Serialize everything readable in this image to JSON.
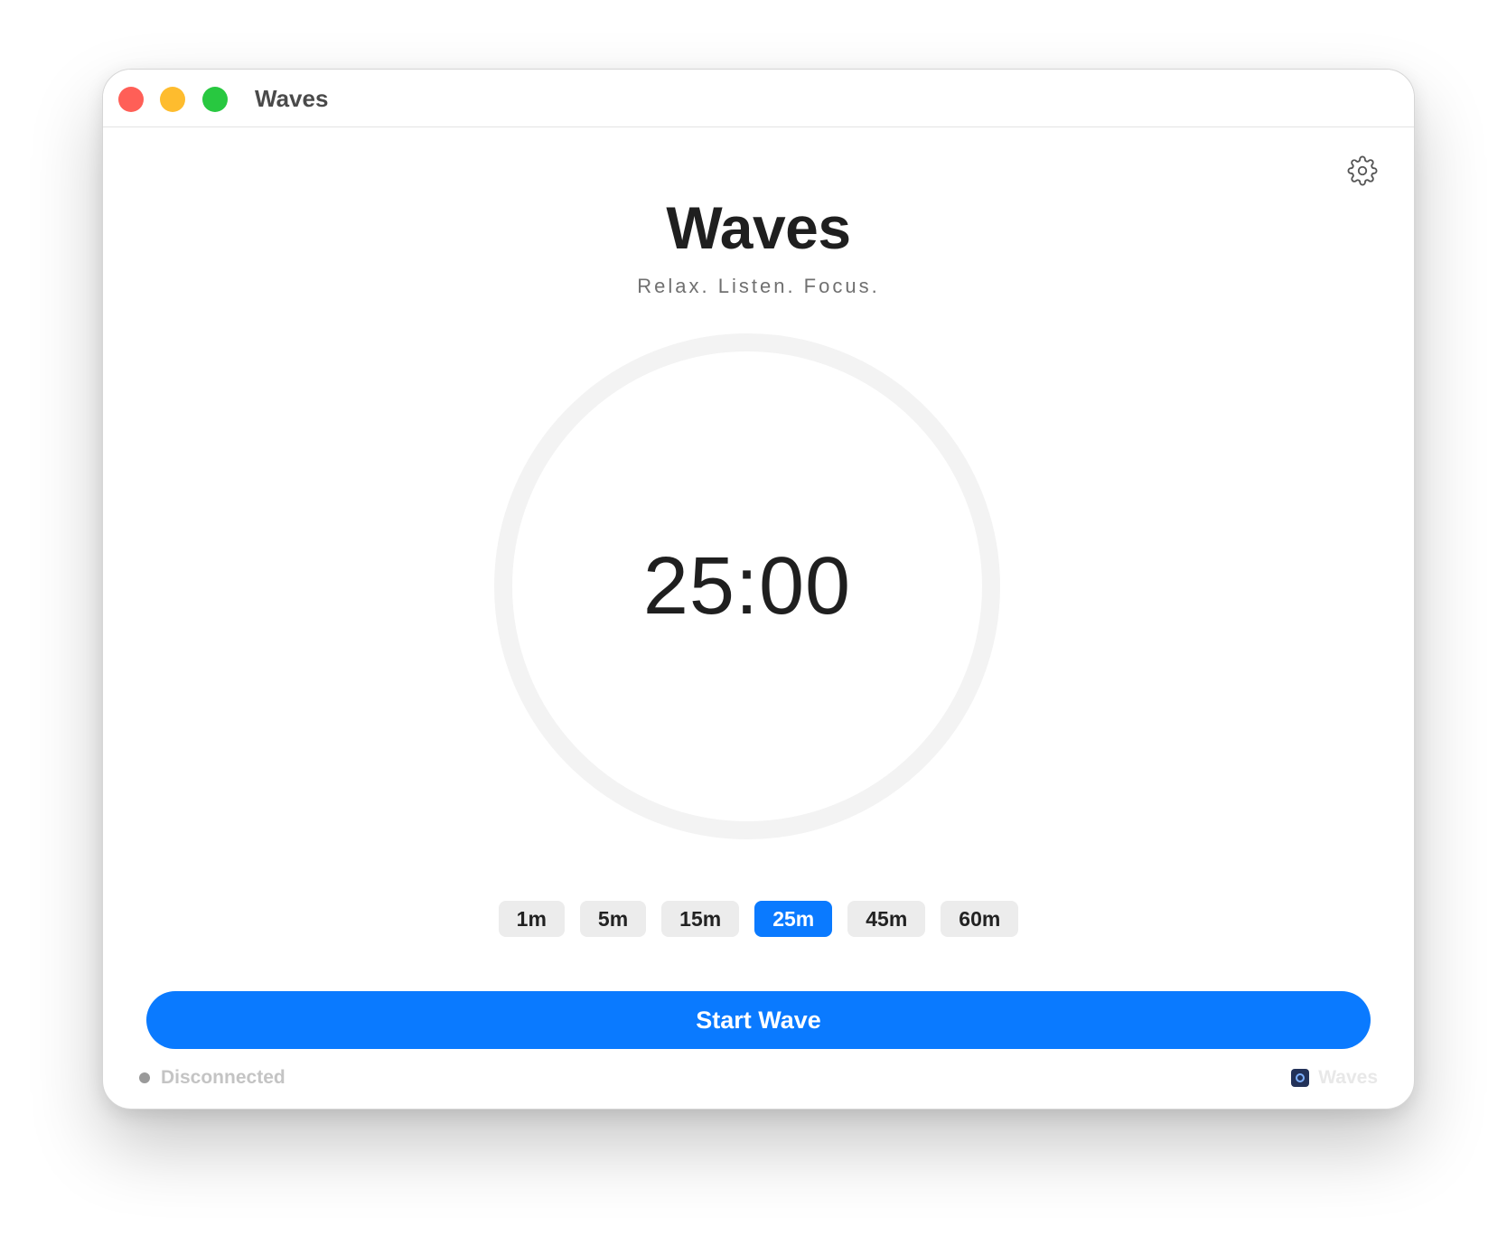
{
  "window": {
    "title": "Waves"
  },
  "header": {
    "app_title": "Waves",
    "tagline": "Relax. Listen. Focus.",
    "settings_icon": "gear-icon"
  },
  "timer": {
    "display": "25:00"
  },
  "durations": {
    "options": [
      "1m",
      "5m",
      "15m",
      "25m",
      "45m",
      "60m"
    ],
    "selected": "25m"
  },
  "actions": {
    "start_label": "Start Wave"
  },
  "footer": {
    "status": "Disconnected",
    "brand": "Waves"
  },
  "colors": {
    "accent": "#0a7aff",
    "close": "#ff5f57",
    "minimize": "#febc2e",
    "maximize": "#28c840"
  }
}
